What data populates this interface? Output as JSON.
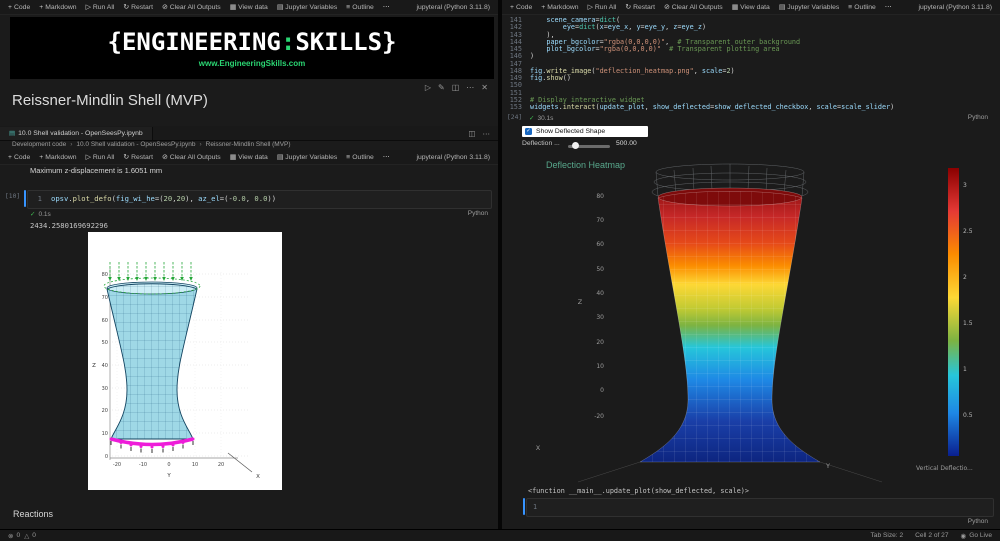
{
  "icons": {
    "notebook": "▤",
    "run": "▷",
    "edit": "✎",
    "split": "◫",
    "more": "⋯",
    "delete": "✕",
    "check": "✓",
    "chevron": "›",
    "error": "⊗",
    "warning": "△",
    "go_live": "◉"
  },
  "toolbar": {
    "items": [
      {
        "glyph": "+",
        "label": "Code"
      },
      {
        "glyph": "+",
        "label": "Markdown"
      },
      {
        "glyph": "▷",
        "label": "Run All"
      },
      {
        "glyph": "↻",
        "label": "Restart"
      },
      {
        "glyph": "⊘",
        "label": "Clear All Outputs"
      },
      {
        "glyph": "▦",
        "label": "View data"
      },
      {
        "glyph": "▤",
        "label": "Jupyter Variables"
      },
      {
        "glyph": "≡",
        "label": "Outline"
      },
      {
        "glyph": "⋯",
        "label": ""
      }
    ],
    "kernel": "jupyteral (Python 3.11.8)"
  },
  "left_pane": {
    "banner": {
      "brace_left": "{",
      "word_a": "ENGINEERING",
      "colon": ":",
      "word_b": "SKILLS",
      "brace_right": "}",
      "url": "www.EngineeringSkills.com"
    },
    "heading": "Reissner-Mindlin Shell (MVP)",
    "tab_title": "10.0 Shell validation - OpenSeesPy.ipynb",
    "breadcrumb": {
      "items": [
        "Development code",
        "10.0 Shell validation - OpenSeesPy.ipynb",
        "Reissner-Mindlin Shell (MVP)"
      ]
    },
    "markdown_text": "Maximum z-displacement is 1.6051 mm",
    "code_cell": {
      "exec_count": "[10]",
      "lines": [
        {
          "n": "1",
          "t": [
            [
              "v",
              "opsv"
            ],
            [
              "p",
              "."
            ],
            [
              "f",
              "plot_defo"
            ],
            [
              "p",
              "("
            ],
            [
              "v",
              "fig_wi_he"
            ],
            [
              "p",
              "=("
            ],
            [
              "n",
              "20"
            ],
            [
              "p",
              ","
            ],
            [
              "n",
              "20"
            ],
            [
              "p",
              "), "
            ],
            [
              "v",
              "az_el"
            ],
            [
              "p",
              "=(-"
            ],
            [
              "n",
              "0.0"
            ],
            [
              "p",
              ", "
            ],
            [
              "n",
              "0.0"
            ],
            [
              "p",
              "))"
            ]
          ]
        }
      ],
      "time": "0.1s",
      "lang": "Python"
    },
    "output_value": "2434.2580169692296",
    "plot": {
      "z_ticks": [
        "80",
        "70",
        "60",
        "50",
        "40",
        "30",
        "20",
        "10",
        "0"
      ],
      "y_ticks": [
        "-20",
        "-10",
        "0",
        "10",
        "20"
      ],
      "xlabel": "X",
      "ylabel": "Y",
      "zlabel": "Z"
    },
    "reactions_heading": "Reactions"
  },
  "right_pane": {
    "code": {
      "lines": [
        {
          "n": "141",
          "t": [
            [
              "w",
              "    "
            ],
            [
              "v",
              "scene_camera"
            ],
            [
              "p",
              "="
            ],
            [
              "t",
              "dict"
            ],
            [
              "p",
              "("
            ]
          ]
        },
        {
          "n": "142",
          "t": [
            [
              "w",
              "        "
            ],
            [
              "v",
              "eye"
            ],
            [
              "p",
              "="
            ],
            [
              "t",
              "dict"
            ],
            [
              "p",
              "("
            ],
            [
              "v",
              "x"
            ],
            [
              "p",
              "="
            ],
            [
              "v",
              "eye_x"
            ],
            [
              "p",
              ", "
            ],
            [
              "v",
              "y"
            ],
            [
              "p",
              "="
            ],
            [
              "v",
              "eye_y"
            ],
            [
              "p",
              ", "
            ],
            [
              "v",
              "z"
            ],
            [
              "p",
              "="
            ],
            [
              "v",
              "eye_z"
            ],
            [
              "p",
              ")"
            ]
          ]
        },
        {
          "n": "143",
          "t": [
            [
              "w",
              "    "
            ],
            [
              "p",
              "),"
            ]
          ]
        },
        {
          "n": "144",
          "t": [
            [
              "w",
              "    "
            ],
            [
              "v",
              "paper_bgcolor"
            ],
            [
              "p",
              "="
            ],
            [
              "s",
              "\"rgba(0,0,0,0)\""
            ],
            [
              "p",
              ","
            ],
            [
              "c",
              "  # Transparent outer background"
            ]
          ]
        },
        {
          "n": "145",
          "t": [
            [
              "w",
              "    "
            ],
            [
              "v",
              "plot_bgcolor"
            ],
            [
              "p",
              "="
            ],
            [
              "s",
              "\"rgba(0,0,0,0)\""
            ],
            [
              "c",
              "  # Transparent plotting area"
            ]
          ]
        },
        {
          "n": "146",
          "t": [
            [
              "p",
              ")"
            ]
          ]
        },
        {
          "n": "147",
          "t": []
        },
        {
          "n": "148",
          "t": [
            [
              "v",
              "fig"
            ],
            [
              "p",
              "."
            ],
            [
              "f",
              "write_image"
            ],
            [
              "p",
              "("
            ],
            [
              "s",
              "\"deflection_heatmap.png\""
            ],
            [
              "p",
              ", "
            ],
            [
              "v",
              "scale"
            ],
            [
              "p",
              "="
            ],
            [
              "n",
              "2"
            ],
            [
              "p",
              ")"
            ]
          ]
        },
        {
          "n": "149",
          "t": [
            [
              "v",
              "fig"
            ],
            [
              "p",
              "."
            ],
            [
              "f",
              "show"
            ],
            [
              "p",
              "()"
            ]
          ]
        },
        {
          "n": "150",
          "t": []
        },
        {
          "n": "151",
          "t": []
        },
        {
          "n": "152",
          "t": [
            [
              "c",
              "# Display interactive widget"
            ]
          ]
        },
        {
          "n": "153",
          "t": [
            [
              "v",
              "widgets"
            ],
            [
              "p",
              "."
            ],
            [
              "f",
              "interact"
            ],
            [
              "p",
              "("
            ],
            [
              "v",
              "update_plot"
            ],
            [
              "p",
              ", "
            ],
            [
              "v",
              "show_deflected"
            ],
            [
              "p",
              "="
            ],
            [
              "v",
              "show_deflected_checkbox"
            ],
            [
              "p",
              ", "
            ],
            [
              "v",
              "scale"
            ],
            [
              "p",
              "="
            ],
            [
              "v",
              "scale_slider"
            ],
            [
              "p",
              ")"
            ]
          ]
        }
      ]
    },
    "exec": {
      "count": "[24]",
      "time": "30.1s",
      "lang": "Python"
    },
    "widgets": {
      "checkbox_label": "Show Deflected Shape",
      "slider_label": "Deflection ...",
      "slider_value": "500.00"
    },
    "figure": {
      "title": "Deflection Heatmap",
      "z_ticks": [
        "80",
        "70",
        "60",
        "50",
        "40",
        "30",
        "20",
        "10",
        "0",
        "-20"
      ],
      "xlabel": "X",
      "ylabel": "Y",
      "zlabel": "Z",
      "colorbar_ticks": [
        "3",
        "2.5",
        "2",
        "1.5",
        "1",
        "0.5"
      ],
      "colorbar_label": "Vertical Deflectio..."
    },
    "output_text": "<function __main__.update_plot(show_deflected, scale)>",
    "empty_cell": {
      "line_no": "1",
      "lang": "Python"
    }
  },
  "status_bar": {
    "errors": "0",
    "warnings": "0",
    "tab_size": "Tab Size: 2",
    "cell_position": "Cell 2 of 27",
    "go_live": "Go Live"
  }
}
